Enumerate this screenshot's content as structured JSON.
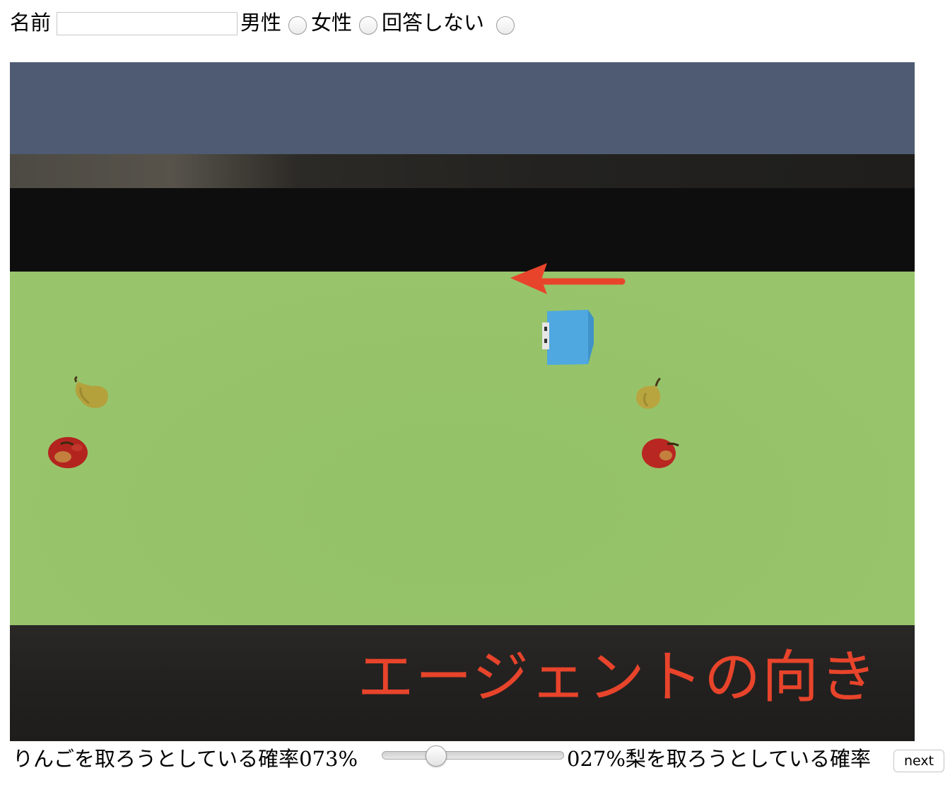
{
  "form": {
    "name_label": "名前",
    "name_value": "",
    "gender_options": [
      "男性",
      "女性",
      "回答しない"
    ]
  },
  "game": {
    "overlay_label": "エージェントの向き",
    "direction_arrow_color": "#e8442b",
    "agent_color": "#4fa8df",
    "floor_color": "#96c36a",
    "sky_color": "#4f5b72",
    "items": [
      "pear-icon",
      "apple-icon",
      "pear-icon",
      "apple-icon"
    ]
  },
  "slider": {
    "left_label": "りんごを取ろうとしている確率",
    "left_value": "073%",
    "right_value": "027%",
    "right_label": "梨を取ろうとしている確率",
    "apple_probability_percent": 73
  },
  "next_button": "next"
}
